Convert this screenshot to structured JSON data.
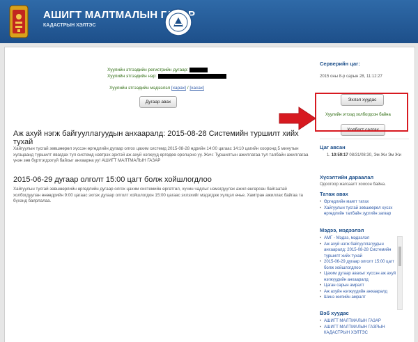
{
  "header": {
    "title": "АШИГТ МАЛТМАЛЫН ГАЗАР",
    "subtitle": "КАДАСТРЫН ХЭЛТЭС"
  },
  "main": {
    "reg_label": "Хуулийн этгээдийн регистрийн дугаар:",
    "name_label": "Хуулийн этгээдийн нэр:",
    "info_label": "Хуулийн этгээдийн мэдээлэл",
    "view_link": "[харах]",
    "slash": "/",
    "hide_link": "[хасах]",
    "number_button": "Дугаар авах",
    "news": [
      {
        "title": "Аж ахуй нэгж байгууллагуудын анхааралд: 2015-08-28 Системийн туршилт хийх тухай",
        "body": "Хайгуулын тусгай зөвшөөрөл хүссэн өргөдлийн дугаар олгох цахим системд 2015-08-28 өдрийн 14:00 цагаас 14:10 цагийн хооронд 5 минутын хугацаанд туршилт явагдах тул системд нэвтрэх эрхтэй аж ахуй нэгжүүд өргөдөө оролцоно уу. Жич: Туршилтын ажиллагаа тул талбайн ажиллагаа үнэн зөв бүртгэгдэхгүй байхыг анхаарна уу! АШИГТ МАЛТМАЛЫН ГАЗАР"
      },
      {
        "title": "2015-06-29 дугаар олголт 15:00 цагт болж хойшлогдлоо",
        "body": "Хайгуулын тусгай зөвшөөрлийн өргөдлийн дугаар олгох цахим системийн өргөтгөл, хүчин чадлыг нэмэгдүүлэх ажил өнгөрсөн байгаатай холбогдуулан өнөөдрийн 9:00 цагаас эхлэх дугаар олголт хойшлогдон 15:00 цагаас эхлэхийг мэдэгдэж хүлцэл өчье. Хамтран ажиллах байгаа та бүхэнд баярлалаа."
      }
    ]
  },
  "sidebar": {
    "server_time_title": "Серверийн цаг:",
    "server_time_value": "2015 оны 8-р сарын 28, 11:12:27",
    "logout_button": "Эхлэл хуудас",
    "connected_text": "Хуулийн этгээд холбогдсон байна",
    "disconnect_button": "Холбогт салгах",
    "time_taken_title": "Цаг авсан",
    "time_taken_index": "1.",
    "time_taken_time": "10:59:17",
    "time_taken_rest": "08/31/08:30, Эм Жи Эм Жи",
    "queue_title": "Хүсэлтийн дараалал",
    "queue_text": "Одоогоор жагсаалт хоосон байна.",
    "downloads_title": "Татаж авах",
    "downloads": [
      "Өргөдлийн маягт татах",
      "Хайгуулын тусгай зөвшөөрөл хүсэх өргөдлийн талбайн зургийн загвар"
    ],
    "news_title": "Мэдээ, мэдээлэл",
    "news_items": [
      "АМГ - Мэдээ, мэдээлэл",
      "Аж ахуй нэгж байгууллагуудын анхааралд: 2015-08-28 Системийн туршилт хийх тухай",
      "2015-06-29 дугаар олголт 15:00 цагт болж хойшлогдлоо",
      "Цахим дугаар авахыг хүссэн аж ахуй нэгжүүдийн анхааралд",
      "Цаган сарын амралт",
      "Аж ахуйн нэгжүүдийн анхааралд",
      "Шинэ жилийн амралт"
    ],
    "web_title": "Вэб хуудас",
    "web_links": [
      "АШИГТ МАЛТМАЛЫН ГАЗАР",
      "АШИГТ МАЛТМАЛЫН ГАЗРЫН КАДАСТРЫН ХЭЛТЭС"
    ]
  },
  "colors": {
    "header_blue": "#2f6aa8",
    "accent_red": "#d71920",
    "label_green": "#2f6d12",
    "link_blue": "#2f5aa8"
  }
}
